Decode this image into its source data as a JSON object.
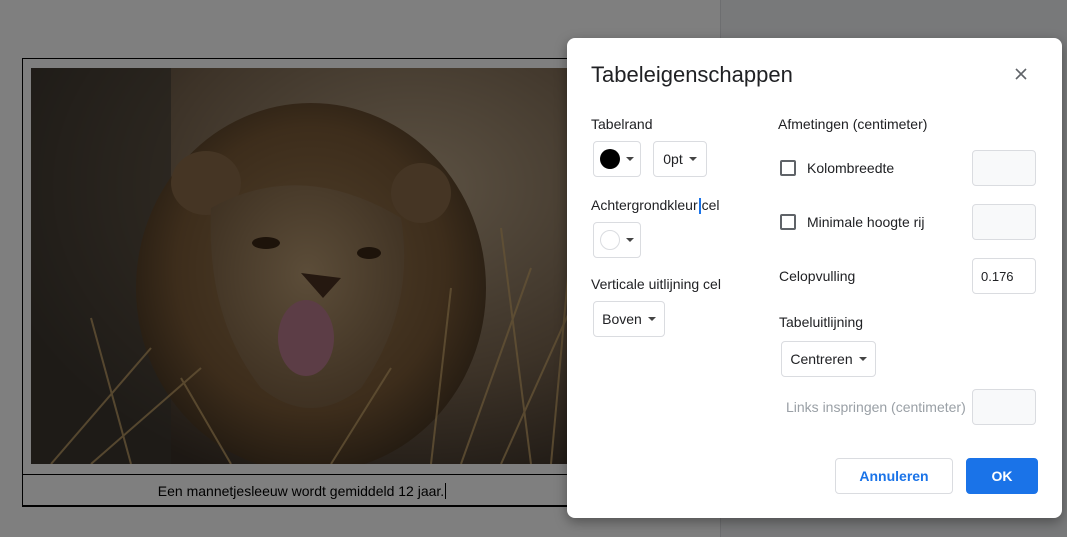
{
  "document": {
    "caption": "Een mannetjesleeuw wordt gemiddeld 12 jaar."
  },
  "dialog": {
    "title": "Tabeleigenschappen",
    "table_border": {
      "label": "Tabelrand",
      "color": "#000000",
      "width_value": "0pt"
    },
    "cell_background": {
      "label_part1": "Achtergrondkleur",
      "label_part2": "cel",
      "color": "#ffffff"
    },
    "vertical_alignment": {
      "label": "Verticale uitlijning cel",
      "value": "Boven"
    },
    "dimensions": {
      "label": "Afmetingen  (centimeter)",
      "column_width_label": "Kolombreedte",
      "column_width_checked": false,
      "column_width_value": "",
      "min_row_height_label": "Minimale hoogte rij",
      "min_row_height_checked": false,
      "min_row_height_value": "",
      "cell_padding_label": "Celopvulling",
      "cell_padding_value": "0.176"
    },
    "table_alignment": {
      "label": "Tabeluitlijning",
      "value": "Centreren",
      "indent_label": "Links inspringen  (centimeter)",
      "indent_value": ""
    },
    "buttons": {
      "cancel": "Annuleren",
      "ok": "OK"
    }
  },
  "icons": {
    "close": "close-icon",
    "dropdown": "chevron-down-icon"
  },
  "colors": {
    "accent": "#1a73e8",
    "overlay": "rgba(0,0,0,0.5)"
  }
}
